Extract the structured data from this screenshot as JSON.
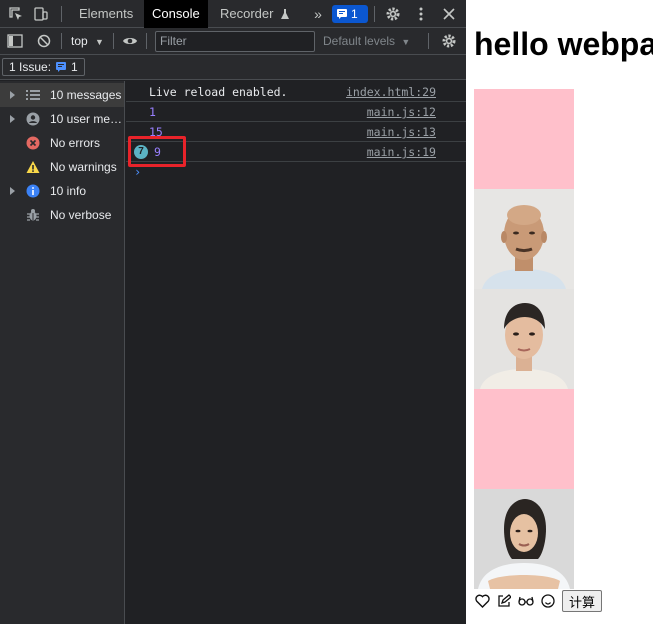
{
  "devtools": {
    "tabs": [
      {
        "label": "Elements"
      },
      {
        "label": "Console"
      },
      {
        "label": "Recorder"
      }
    ],
    "issues_badge_count": "1",
    "context": "top",
    "filter_placeholder": "Filter",
    "levels_label": "Default levels",
    "issue_bar": {
      "label": "1 Issue:",
      "count": "1"
    },
    "sidebar": [
      {
        "label": "10 messages",
        "icon": "list-icon"
      },
      {
        "label": "10 user me…",
        "icon": "user-icon"
      },
      {
        "label": "No errors",
        "icon": "error-icon"
      },
      {
        "label": "No warnings",
        "icon": "warning-icon"
      },
      {
        "label": "10 info",
        "icon": "info-icon"
      },
      {
        "label": "No verbose",
        "icon": "bug-icon"
      }
    ],
    "messages": [
      {
        "text": "Live reload enabled.",
        "source": "index.html:29"
      },
      {
        "text": "1",
        "source": "main.js:12"
      },
      {
        "text": "15",
        "source": "main.js:13"
      },
      {
        "text": "9",
        "source": "main.js:19",
        "repeat": "7"
      }
    ],
    "prompt_symbol": "›"
  },
  "webpage": {
    "title": "hello webpa",
    "calc_button": "计算"
  },
  "colors": {
    "pink_tile": "#ffc0cb",
    "highlight": "#e8232a",
    "accent_blue": "#0b57d0"
  }
}
